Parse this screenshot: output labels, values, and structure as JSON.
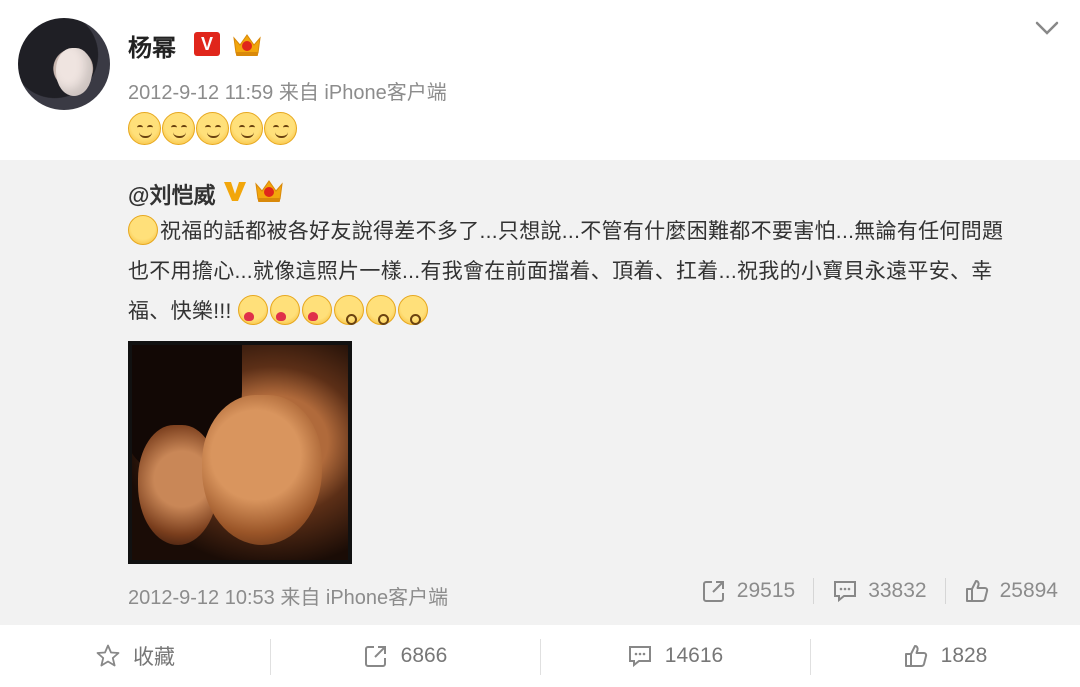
{
  "post": {
    "author": "杨幂",
    "verified_badge": "V",
    "meta": "2012-9-12 11:59 来自 iPhone客户端",
    "emoji_count": 5
  },
  "repost": {
    "author": "@刘恺威",
    "text_line1": "祝福的話都被各好友說得差不多了...只想說...不管有什麼困難都不要害怕...無論有任何問題",
    "text_line2": "也不用擔心...就像這照片一樣...有我會在前面擋着、頂着、扛着...祝我的小寶貝永遠平安、幸",
    "text_line3": "福、快樂!!!",
    "meta": "2012-9-12 10:53 来自 iPhone客户端",
    "reposts": "29515",
    "comments": "33832",
    "likes": "25894"
  },
  "actions": {
    "favorite_label": "收藏",
    "reposts": "6866",
    "comments": "14616",
    "likes": "1828"
  },
  "colors": {
    "verified_red": "#e0261b",
    "verified_gold": "#f2a60c",
    "meta_gray": "#8c8c8c",
    "repost_bg": "#f2f2f2"
  },
  "icons": {
    "menu": "chevron-down-icon",
    "repost": "share-icon",
    "comment": "comment-icon",
    "like": "thumbs-up-icon",
    "favorite": "star-icon"
  }
}
